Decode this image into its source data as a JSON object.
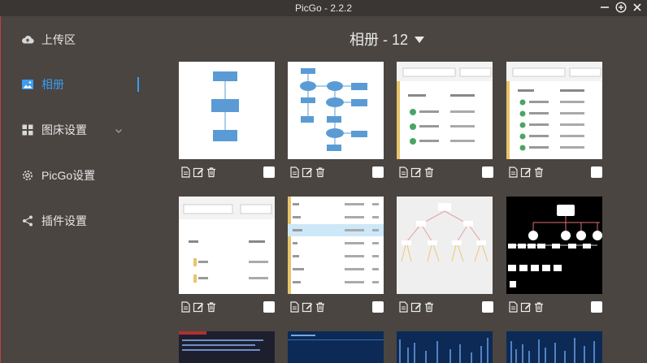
{
  "window": {
    "title": "PicGo - 2.2.2"
  },
  "sidebar": {
    "items": [
      {
        "label": "上传区",
        "icon": "cloud-upload-icon"
      },
      {
        "label": "相册",
        "icon": "image-icon",
        "active": true
      },
      {
        "label": "图床设置",
        "icon": "grid-icon"
      },
      {
        "label": "PicGo设置",
        "icon": "gear-icon"
      },
      {
        "label": "插件设置",
        "icon": "share-icon"
      }
    ]
  },
  "main": {
    "album_title": "相册 - 12",
    "images": [
      {
        "name": "flowchart-1",
        "selected": false
      },
      {
        "name": "flowchart-2",
        "selected": false
      },
      {
        "name": "explorer-front",
        "selected": false
      },
      {
        "name": "explorer-admin",
        "selected": false
      },
      {
        "name": "explorer-view",
        "selected": false
      },
      {
        "name": "explorer-list",
        "selected": false
      },
      {
        "name": "tree-diagram-light",
        "selected": false
      },
      {
        "name": "tree-diagram-dark",
        "selected": false
      },
      {
        "name": "terminal-1",
        "selected": false
      },
      {
        "name": "terminal-2",
        "selected": false
      },
      {
        "name": "chart-blue-1",
        "selected": false
      },
      {
        "name": "chart-blue-2",
        "selected": false
      }
    ]
  },
  "colors": {
    "accent": "#3d9cf0",
    "background": "#4a4541"
  }
}
